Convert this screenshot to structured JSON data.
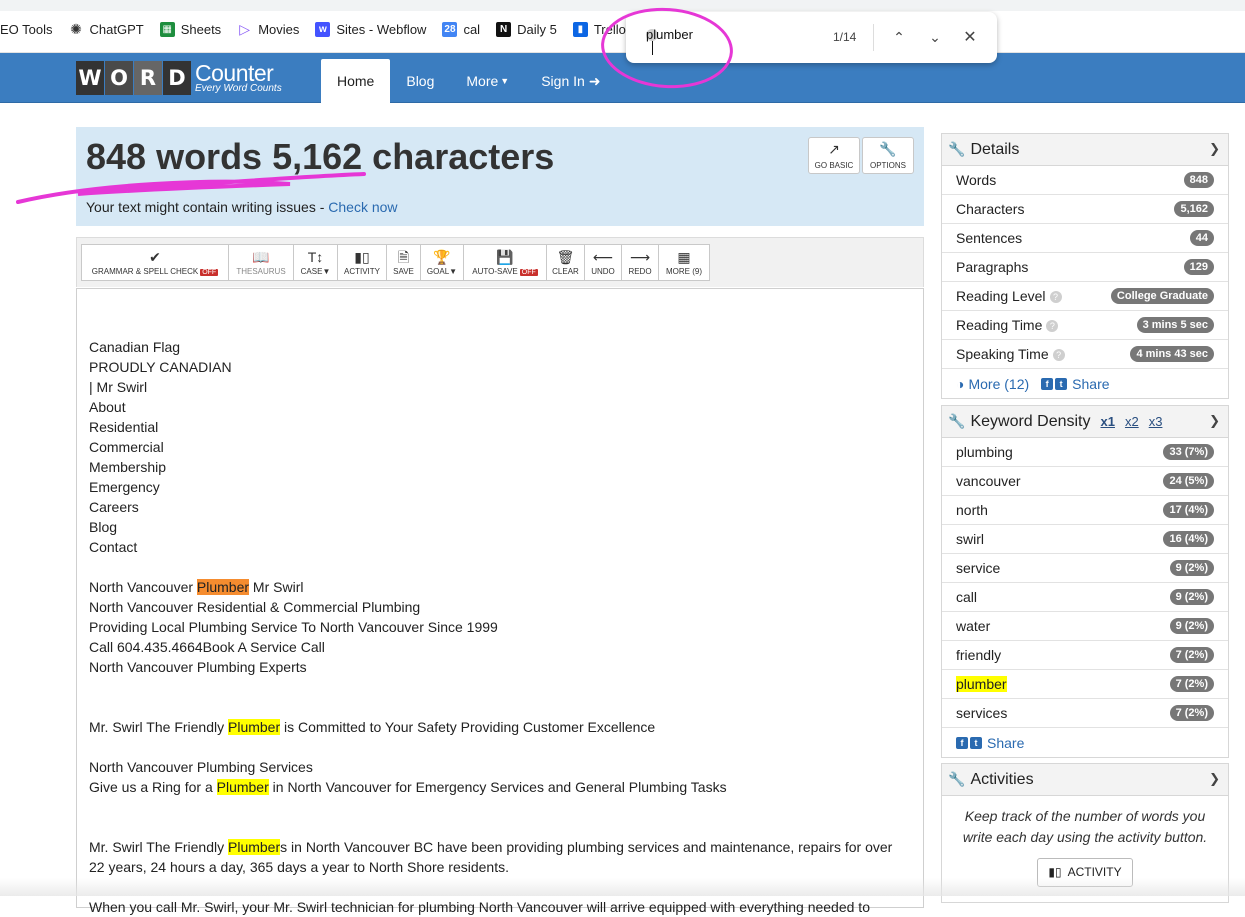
{
  "bookmarks": [
    {
      "label": "EO Tools",
      "icon": "folder-icon",
      "color": "#555555"
    },
    {
      "label": "ChatGPT",
      "icon": "chatgpt-icon",
      "color": "#333333"
    },
    {
      "label": "Sheets",
      "icon": "sheets-icon",
      "color": "#1e8e3e"
    },
    {
      "label": "Movies",
      "icon": "play-icon",
      "color": "#8a5cf6"
    },
    {
      "label": "Sites - Webflow",
      "icon": "webflow-icon",
      "color": "#4353ff"
    },
    {
      "label": "cal",
      "icon": "calendar-icon",
      "color": "#4285f4"
    },
    {
      "label": "Daily 5",
      "icon": "notion-icon",
      "color": "#111111"
    },
    {
      "label": "Trello",
      "icon": "trello-icon",
      "color": "#0c66e4"
    }
  ],
  "find": {
    "query": "plumber",
    "count": "1/14"
  },
  "nav": {
    "logo_letters": [
      "W",
      "O",
      "R",
      "D"
    ],
    "logo_word": "Counter",
    "logo_tagline": "Every Word Counts",
    "links": [
      "Home",
      "Blog",
      "More",
      "Sign In"
    ]
  },
  "summary": {
    "title": "848 words 5,162 characters",
    "warning": "Your text might contain writing issues - ",
    "check_link": "Check now",
    "go_basic": "GO BASIC",
    "options": "OPTIONS"
  },
  "toolbar": {
    "grammar": "GRAMMAR & SPELL CHECK",
    "off": "OFF",
    "thesaurus": "THESAURUS",
    "case": "CASE",
    "activity": "ACTIVITY",
    "save": "SAVE",
    "goal": "GOAL",
    "autosave": "AUTO-SAVE",
    "clear": "CLEAR",
    "undo": "UNDO",
    "redo": "REDO",
    "more": "MORE (9)"
  },
  "editor": {
    "lines": [
      "",
      "Canadian Flag",
      "PROUDLY CANADIAN",
      "| Mr Swirl",
      "About",
      "Residential",
      "Commercial",
      "Membership",
      "Emergency",
      "Careers",
      "Blog",
      "Contact",
      "",
      {
        "pre": "North Vancouver ",
        "hl": "Plumber",
        "post": " Mr Swirl",
        "current": true
      },
      "North Vancouver Residential & Commercial Plumbing",
      "Providing Local Plumbing Service To North Vancouver Since 1999",
      "Call 604.435.4664Book A Service Call",
      "North Vancouver Plumbing Experts",
      "",
      "",
      {
        "pre": "Mr. Swirl The Friendly ",
        "hl": "Plumber",
        "post": " is Committed to Your Safety Providing Customer Excellence"
      },
      "",
      "North Vancouver Plumbing Services",
      {
        "pre": "Give us a Ring for a ",
        "hl": "Plumber",
        "post": " in North Vancouver for Emergency Services and General Plumbing Tasks"
      },
      "",
      "",
      {
        "pre": "Mr. Swirl The Friendly ",
        "hl": "Plumber",
        "post": "s in North Vancouver BC have been providing plumbing services and maintenance, repairs for over 22 years, 24 hours a day, 365 days a year to North Shore residents.",
        "wrap": true
      },
      "",
      "When you call Mr. Swirl, your Mr. Swirl technician for plumbing North Vancouver will arrive equipped with everything needed to"
    ]
  },
  "details": {
    "title": "Details",
    "rows": [
      {
        "label": "Words",
        "value": "848",
        "help": false
      },
      {
        "label": "Characters",
        "value": "5,162",
        "help": false
      },
      {
        "label": "Sentences",
        "value": "44",
        "help": false
      },
      {
        "label": "Paragraphs",
        "value": "129",
        "help": false
      },
      {
        "label": "Reading Level",
        "value": "College Graduate",
        "help": true
      },
      {
        "label": "Reading Time",
        "value": "3 mins 5 sec",
        "help": true
      },
      {
        "label": "Speaking Time",
        "value": "4 mins 43 sec",
        "help": true
      }
    ],
    "more": "More (12)",
    "share": "Share"
  },
  "density": {
    "title": "Keyword Density",
    "tabs": [
      "x1",
      "x2",
      "x3"
    ],
    "rows": [
      {
        "word": "plumbing",
        "value": "33 (7%)"
      },
      {
        "word": "vancouver",
        "value": "24 (5%)"
      },
      {
        "word": "north",
        "value": "17 (4%)"
      },
      {
        "word": "swirl",
        "value": "16 (4%)"
      },
      {
        "word": "service",
        "value": "9 (2%)"
      },
      {
        "word": "call",
        "value": "9 (2%)"
      },
      {
        "word": "water",
        "value": "9 (2%)"
      },
      {
        "word": "friendly",
        "value": "7 (2%)"
      },
      {
        "word": "plumber",
        "value": "7 (2%)",
        "highlight": true
      },
      {
        "word": "services",
        "value": "7 (2%)"
      }
    ],
    "share": "Share"
  },
  "activities": {
    "title": "Activities",
    "desc": "Keep track of the number of words you write each day using the activity button.",
    "button": "ACTIVITY"
  },
  "colors": {
    "nav": "#3b7dc0",
    "hero": "#d6e8f5",
    "highlight": "#ffff00",
    "current_highlight": "#f58c2f",
    "annotation": "#e637d6"
  }
}
